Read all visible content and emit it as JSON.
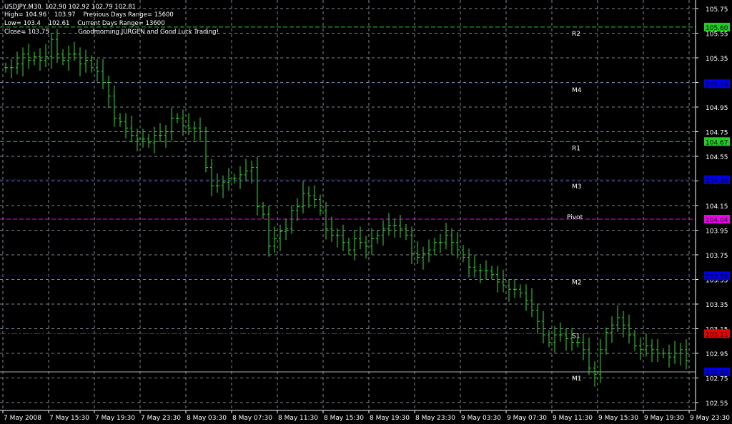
{
  "header": {
    "line1": "USDJPY,M30  102.90 102.92 102.79 102.81",
    "line2": "High= 104.96    103.97    Previous Days Range= 15600",
    "line3": "Low= 103.4    102.61    Current Days Range= 13600",
    "line4": "Close= 103.75               Goodmorning JURGEN and Good Luck Trading!"
  },
  "colors": {
    "bar": "#22e022",
    "grid": "#7f8a99",
    "bg": "#000000",
    "axis": "#ffffff"
  },
  "chart_data": {
    "type": "ohlc-bar",
    "symbol": "USDJPY",
    "timeframe": "M30",
    "ylim": [
      102.48,
      105.82
    ],
    "y_ticks": [
      "105.75",
      "105.55",
      "105.35",
      "105.15",
      "104.95",
      "104.75",
      "104.55",
      "104.35",
      "104.15",
      "103.95",
      "103.75",
      "103.55",
      "103.35",
      "103.15",
      "102.95",
      "102.75",
      "102.55"
    ],
    "x_ticks": [
      "7 May 2008",
      "7 May 15:30",
      "7 May 19:30",
      "7 May 23:30",
      "8 May 03:30",
      "8 May 07:30",
      "8 May 11:30",
      "8 May 15:30",
      "8 May 19:30",
      "8 May 23:30",
      "9 May 03:30",
      "9 May 07:30",
      "9 May 11:30",
      "9 May 15:30",
      "9 May 19:30",
      "9 May 23:30"
    ],
    "closes": [
      105.27,
      105.27,
      105.3,
      105.38,
      105.33,
      105.36,
      105.33,
      105.36,
      105.5,
      105.38,
      105.33,
      105.38,
      105.38,
      105.3,
      105.33,
      105.27,
      105.24,
      105.15,
      105.04,
      104.86,
      104.83,
      104.78,
      104.72,
      104.69,
      104.69,
      104.66,
      104.72,
      104.72,
      104.75,
      104.86,
      104.86,
      104.8,
      104.78,
      104.78,
      104.75,
      104.46,
      104.31,
      104.31,
      104.34,
      104.37,
      104.37,
      104.4,
      104.43,
      104.46,
      104.14,
      104.08,
      103.82,
      103.88,
      103.94,
      103.96,
      104.11,
      104.14,
      104.25,
      104.23,
      104.2,
      104.11,
      103.96,
      103.91,
      103.91,
      103.85,
      103.79,
      103.88,
      103.85,
      103.82,
      103.88,
      103.91,
      103.96,
      103.99,
      103.99,
      103.96,
      103.91,
      103.76,
      103.73,
      103.76,
      103.79,
      103.85,
      103.85,
      103.91,
      103.85,
      103.79,
      103.73,
      103.65,
      103.62,
      103.62,
      103.62,
      103.59,
      103.53,
      103.5,
      103.47,
      103.47,
      103.44,
      103.38,
      103.3,
      103.21,
      103.1,
      103.04,
      103.1,
      103.1,
      103.07,
      103.04,
      103.04,
      102.98,
      102.83,
      102.78,
      102.98,
      103.12,
      103.18,
      103.24,
      103.18,
      103.1,
      103.01,
      102.98,
      103.01,
      102.98,
      102.95,
      102.95,
      102.92,
      102.95,
      102.98,
      102.89
    ],
    "levels": [
      {
        "name": "R2",
        "value": 105.6,
        "label": "105.60",
        "color": "#22cc22",
        "text": "#000000",
        "style": "dash"
      },
      {
        "name": "M4",
        "value": 105.14,
        "label": "105.14",
        "color": "#0000ee",
        "text": "#000000",
        "style": "dash"
      },
      {
        "name": "R1",
        "value": 104.67,
        "label": "104.67",
        "color": "#22cc22",
        "text": "#000000",
        "style": "dash"
      },
      {
        "name": "M3",
        "value": 104.36,
        "label": "104.36",
        "color": "#0000ee",
        "text": "#000000",
        "style": "dash"
      },
      {
        "name": "Pivot",
        "value": 104.04,
        "label": "104.04",
        "color": "#ee00ee",
        "text": "#000000",
        "style": "dash"
      },
      {
        "name": "M2",
        "value": 103.58,
        "label": "103.58",
        "color": "#0000ee",
        "text": "#000000",
        "style": "dash"
      },
      {
        "name": "S1",
        "value": 103.11,
        "label": "103.11",
        "color": "#ee0000",
        "text": "#000000",
        "style": "dashdot"
      },
      {
        "name": "M1",
        "value": 102.8,
        "label": "102.80",
        "color": "#0000ee",
        "text": "#000000",
        "style": "dash"
      }
    ]
  }
}
